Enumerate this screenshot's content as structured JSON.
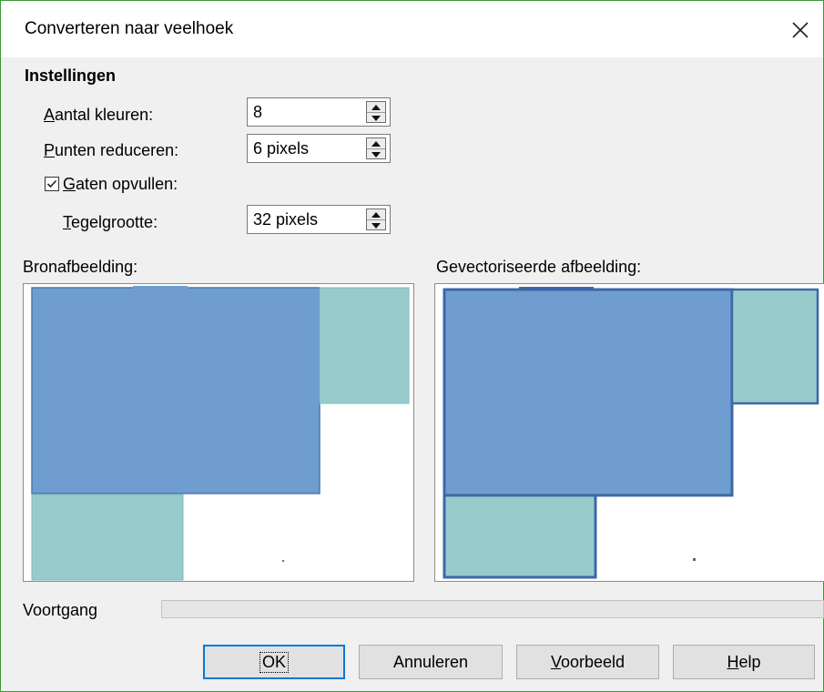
{
  "dialog": {
    "title": "Converteren naar veelhoek",
    "close_icon": "close-icon"
  },
  "settings": {
    "heading": "Instellingen",
    "colors": {
      "label_underlined": "A",
      "label_rest": "antal kleuren:",
      "value": "8"
    },
    "reduce_points": {
      "label_underlined": "P",
      "label_rest": "unten reduceren:",
      "value": "6 pixels"
    },
    "fill_holes": {
      "checked": true,
      "label_underlined": "G",
      "label_rest": "aten opvullen:"
    },
    "tile_size": {
      "label_underlined": "T",
      "label_rest": "egelgrootte:",
      "value": "32 pixels"
    }
  },
  "previews": {
    "source_label": "Bronafbeelding:",
    "vectorized_label": "Gevectoriseerde afbeelding:",
    "colors": {
      "blue": "#6f9dcf",
      "teal": "#98cccc",
      "outline": "#3c68a8"
    }
  },
  "progress": {
    "label": "Voortgang",
    "value": 0
  },
  "buttons": {
    "ok": "OK",
    "cancel": "Annuleren",
    "preview_underlined": "V",
    "preview_rest": "oorbeeld",
    "help_underlined": "H",
    "help_rest": "elp"
  }
}
